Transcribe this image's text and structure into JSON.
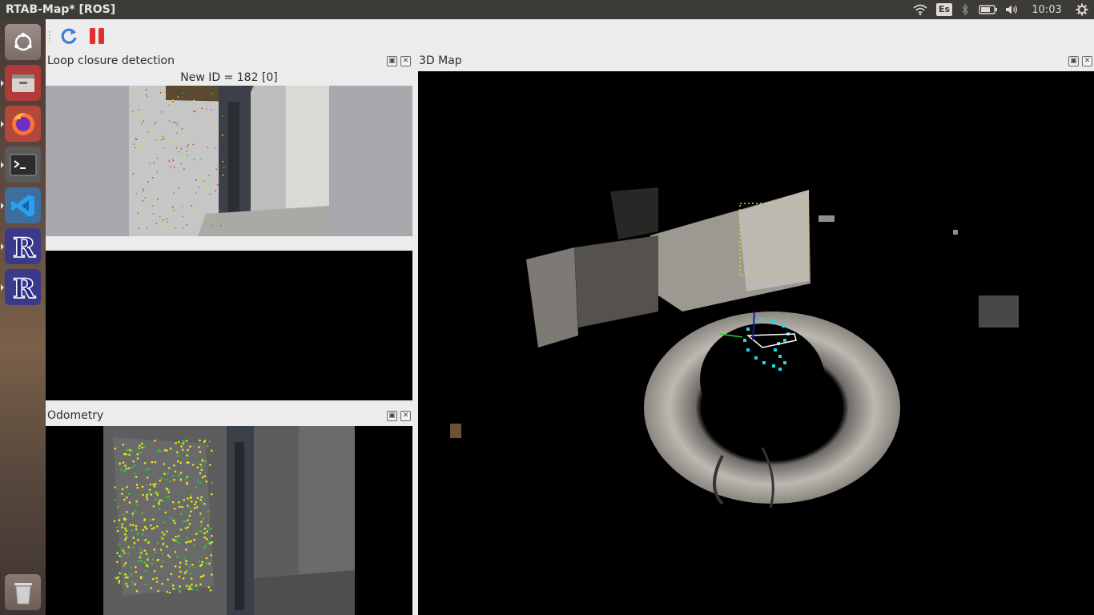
{
  "window": {
    "title": "RTAB-Map* [ROS]"
  },
  "tray": {
    "keyboard_layout": "Es",
    "clock": "10:03",
    "icons": [
      "wifi-icon",
      "keyboard-layout-icon",
      "bluetooth-icon",
      "battery-icon",
      "volume-icon",
      "settings-gear-icon"
    ]
  },
  "launcher": {
    "items": [
      "ubuntu-dash",
      "files",
      "firefox",
      "terminal",
      "vscode",
      "rviz",
      "rviz",
      "trash"
    ]
  },
  "toolbar": {
    "buttons": [
      "refresh",
      "pause"
    ],
    "colors": {
      "refresh": "#3a7fd5",
      "pause": "#e03030"
    }
  },
  "loop_panel": {
    "title": "Loop closure detection",
    "new_id_label": "New ID = 182 [0]"
  },
  "odometry_panel": {
    "title": "Odometry"
  },
  "map_panel": {
    "title": "3D Map"
  },
  "colors": {
    "feature_yellow": "#e6e619",
    "feature_green": "#35c035",
    "trajectory_cyan": "#20d8e8",
    "panel_bg": "#ececec",
    "topbar_bg": "#3c3b37"
  }
}
